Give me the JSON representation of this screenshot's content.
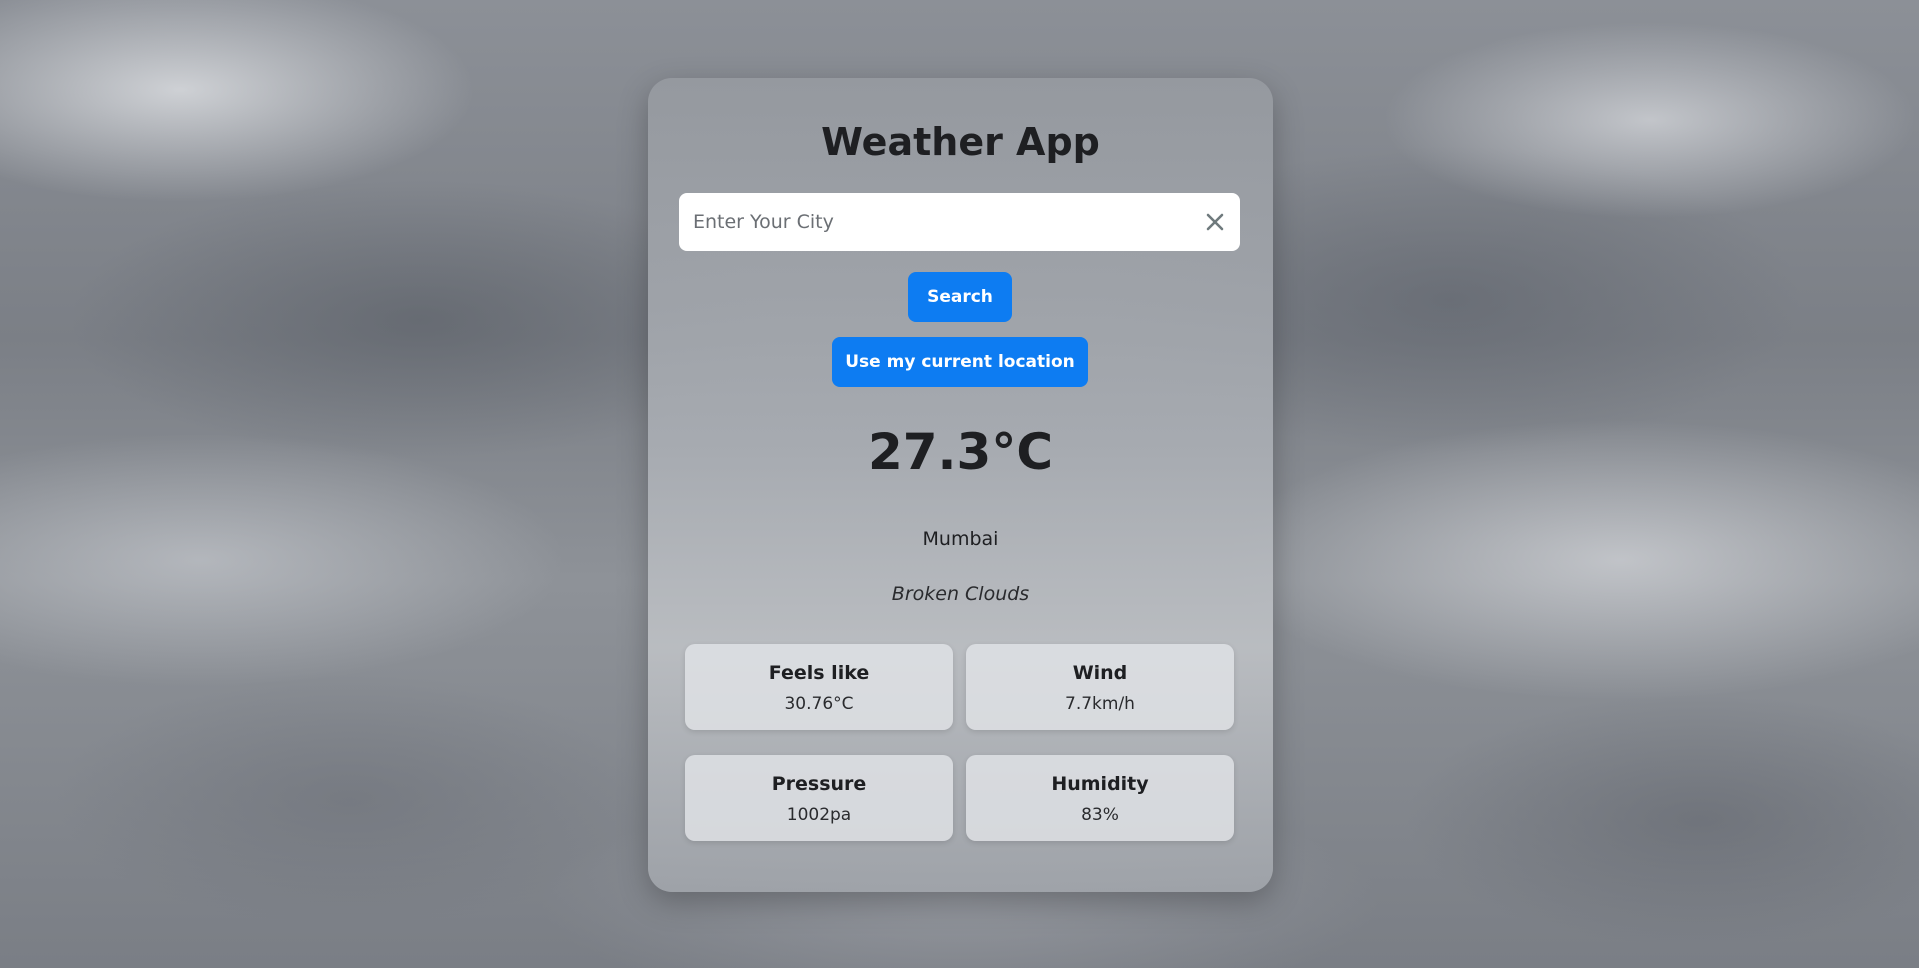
{
  "app": {
    "title": "Weather App"
  },
  "search": {
    "placeholder": "Enter Your City",
    "value": "",
    "clear_icon": "close-icon",
    "search_label": "Search",
    "location_label": "Use my current location"
  },
  "current": {
    "temperature": "27.3°C",
    "city": "Mumbai",
    "description": "Broken Clouds"
  },
  "details": [
    {
      "label": "Feels like",
      "value": "30.76°C"
    },
    {
      "label": "Wind",
      "value": "7.7km/h"
    },
    {
      "label": "Pressure",
      "value": "1002pa"
    },
    {
      "label": "Humidity",
      "value": "83%"
    }
  ],
  "colors": {
    "button": "#0d7cf2",
    "button_text": "#ffffff",
    "text": "#1e1f22"
  }
}
